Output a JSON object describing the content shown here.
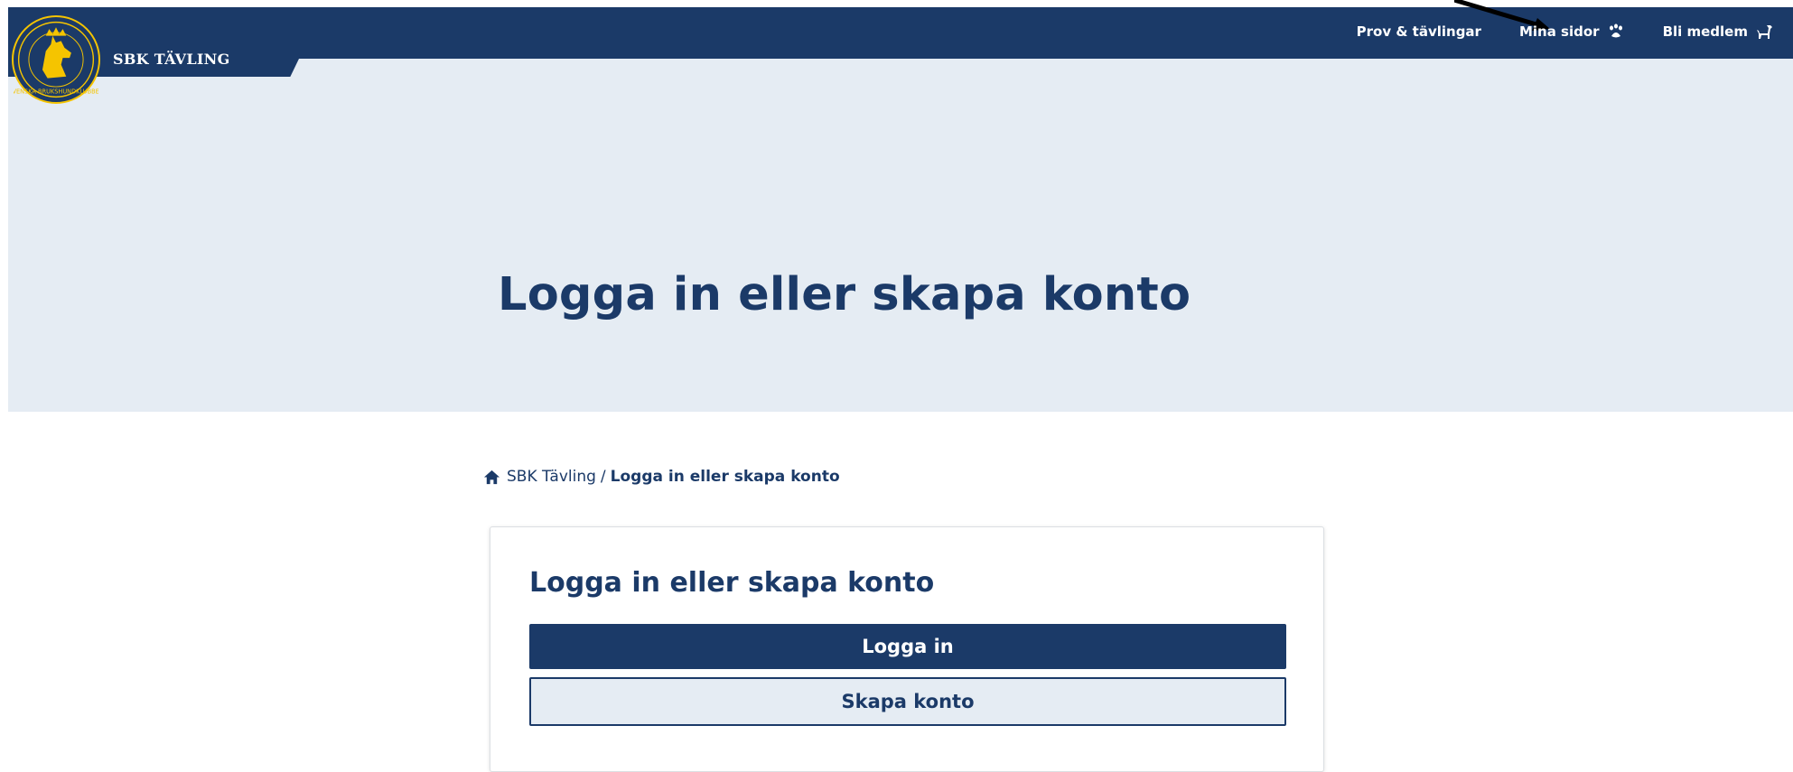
{
  "header": {
    "brand": "SBK TÄVLING",
    "logo_icon": "sbk-dog-seal-logo",
    "nav": [
      {
        "label": "Prov & tävlingar",
        "icon": ""
      },
      {
        "label": "Mina sidor",
        "icon": "paw-icon"
      },
      {
        "label": "Bli medlem",
        "icon": "dog-icon"
      }
    ]
  },
  "hero": {
    "title": "Logga in eller skapa konto"
  },
  "breadcrumb": {
    "home_label": "SBK Tävling",
    "separator": "/",
    "current": "Logga in eller skapa konto"
  },
  "login_card": {
    "title": "Logga in eller skapa konto",
    "login_button": "Logga in",
    "create_button": "Skapa konto"
  },
  "colors": {
    "brand_navy": "#1b3a68",
    "hero_bg": "#e5ecf3",
    "logo_gold": "#f5c400"
  }
}
